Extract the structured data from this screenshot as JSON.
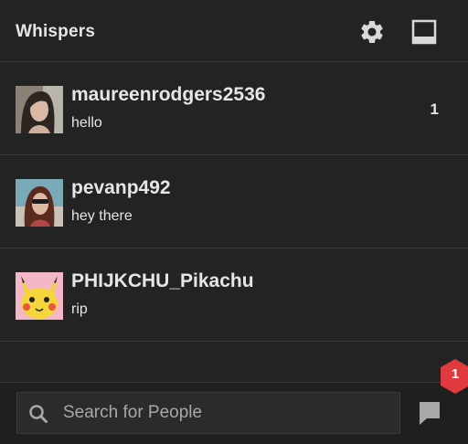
{
  "header": {
    "title": "Whispers",
    "settings_icon": "gear-icon",
    "dock_icon": "window-dock-icon"
  },
  "threads": [
    {
      "username": "maureenrodgers2536",
      "last_message": "hello",
      "unread_count": "1"
    },
    {
      "username": "pevanp492",
      "last_message": "hey there",
      "unread_count": ""
    },
    {
      "username": "PHIJKCHU_Pikachu",
      "last_message": "rip",
      "unread_count": ""
    }
  ],
  "search": {
    "placeholder": "Search for People",
    "value": ""
  },
  "notification": {
    "count": "1",
    "color": "#e0393e"
  },
  "colors": {
    "background": "#232323",
    "text": "#e6e6e6",
    "divider": "#3a3a3a"
  }
}
